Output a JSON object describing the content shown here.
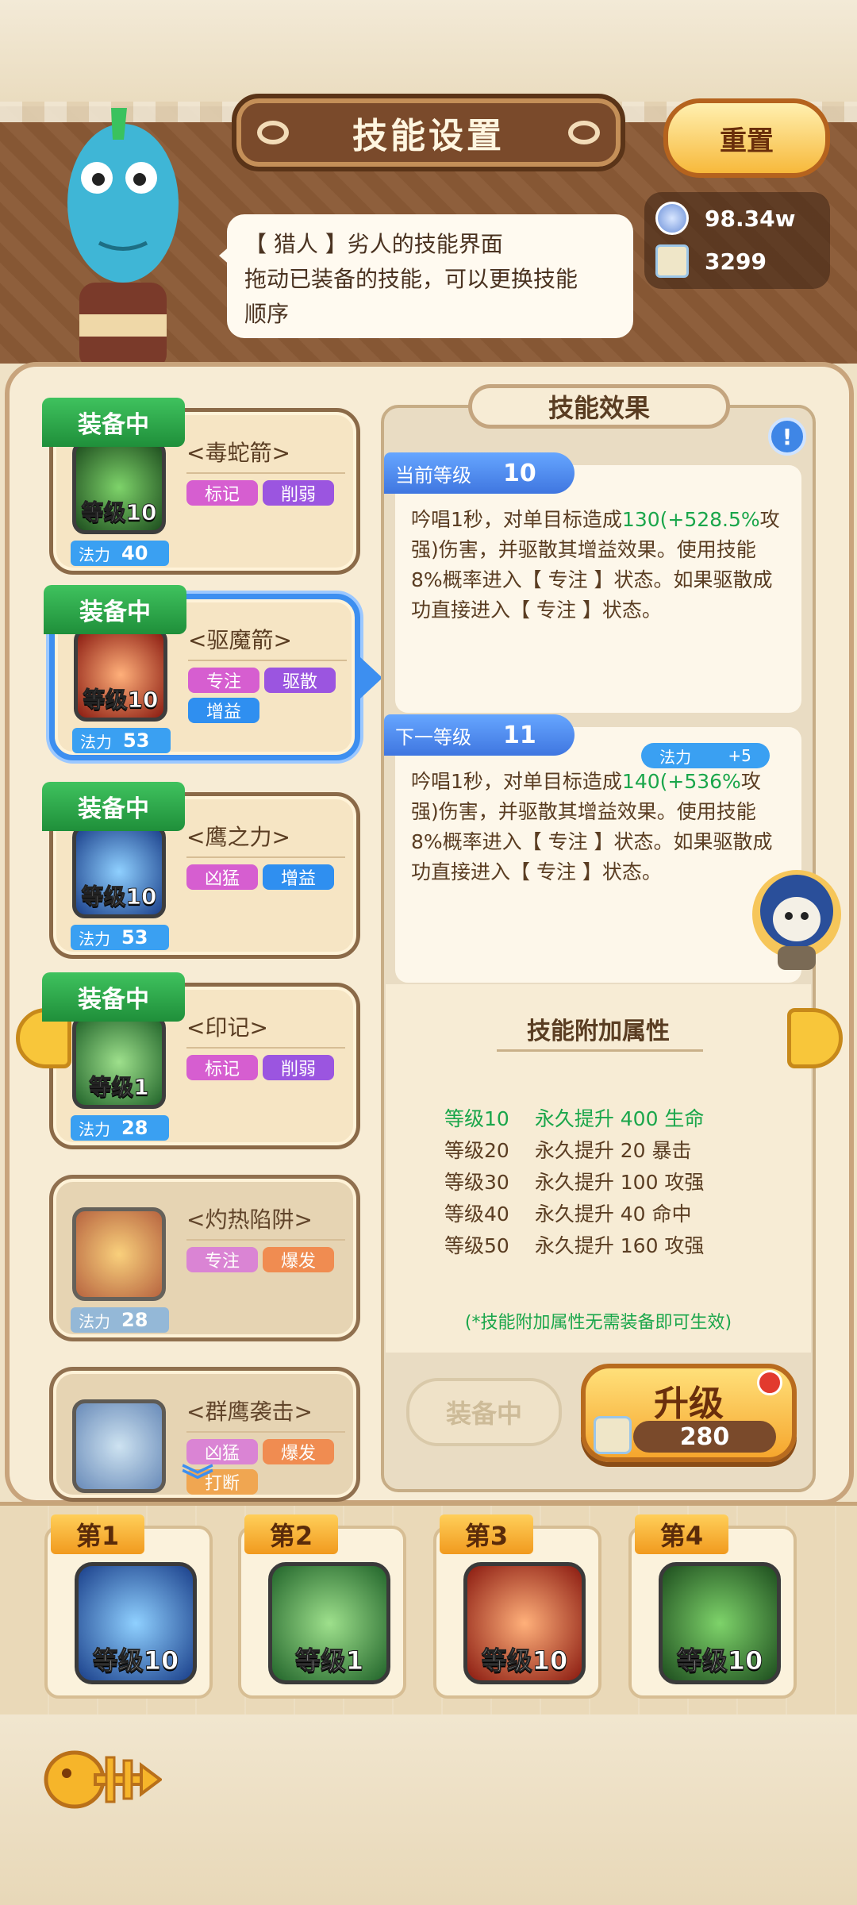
{
  "header": {
    "title": "技能设置",
    "reset_label": "重置"
  },
  "resources": {
    "coins": "98.34w",
    "scrolls": "3299"
  },
  "bubble": {
    "line1": "【 猎人 】劣人的技能界面",
    "line2": "拖动已装备的技能，可以更换技能",
    "line3": "顺序"
  },
  "skills": [
    {
      "name": "<毒蛇箭>",
      "equipped": "装备中",
      "level": "等级10",
      "mana_label": "法力",
      "mana": "40",
      "tags": [
        "标记",
        "削弱"
      ]
    },
    {
      "name": "<驱魔箭>",
      "equipped": "装备中",
      "level": "等级10",
      "mana_label": "法力",
      "mana": "53",
      "tags": [
        "专注",
        "驱散",
        "增益"
      ]
    },
    {
      "name": "<鹰之力>",
      "equipped": "装备中",
      "level": "等级10",
      "mana_label": "法力",
      "mana": "53",
      "tags": [
        "凶猛",
        "增益"
      ]
    },
    {
      "name": "<印记>",
      "equipped": "装备中",
      "level": "等级1",
      "mana_label": "法力",
      "mana": "28",
      "tags": [
        "标记",
        "削弱"
      ]
    },
    {
      "name": "<灼热陷阱>",
      "mana_label": "法力",
      "mana": "28",
      "tags": [
        "专注",
        "爆发"
      ]
    },
    {
      "name": "<群鹰袭击>",
      "tags": [
        "凶猛",
        "爆发",
        "打断"
      ]
    }
  ],
  "effect": {
    "title": "技能效果",
    "current_label": "当前等级",
    "current_level": "10",
    "current_desc": [
      "吟唱1秒，对单目标造成",
      "130",
      "(+528.5%",
      "攻强)伤害，并驱散其增益效果。使用技能8%概率进入【 专注 】状态。如果驱散成功直接进入【 专注 】状态。"
    ],
    "next_label": "下一等级",
    "next_level": "11",
    "next_mana_label": "法力",
    "next_mana": "+5",
    "next_desc": [
      "吟唱1秒，对单目标造成",
      "140",
      "(+536%",
      "攻强)伤害，并驱散其增益效果。使用技能8%概率进入【 专注 】状态。如果驱散成功直接进入【 专注 】状态。"
    ]
  },
  "attributes": {
    "title": "技能附加属性",
    "rows": [
      {
        "level": "等级10",
        "bonus": "永久提升 400 生命"
      },
      {
        "level": "等级20",
        "bonus": "永久提升 20 暴击"
      },
      {
        "level": "等级30",
        "bonus": "永久提升 100 攻强"
      },
      {
        "level": "等级40",
        "bonus": "永久提升 40 命中"
      },
      {
        "level": "等级50",
        "bonus": "永久提升 160 攻强"
      }
    ],
    "note": "(*技能附加属性无需装备即可生效)"
  },
  "actions": {
    "equipped_label": "装备中",
    "upgrade_label": "升级",
    "upgrade_cost": "280"
  },
  "slots": [
    {
      "label": "第1",
      "level": "等级10"
    },
    {
      "label": "第2",
      "level": "等级1"
    },
    {
      "label": "第3",
      "level": "等级10"
    },
    {
      "label": "第4",
      "level": "等级10"
    }
  ],
  "colors": {
    "equipped_ribbon": "#2fae4f",
    "selection": "#3d8ff0",
    "highlight_value": "#1aa64b",
    "level_tab": "#4f8ff0"
  }
}
